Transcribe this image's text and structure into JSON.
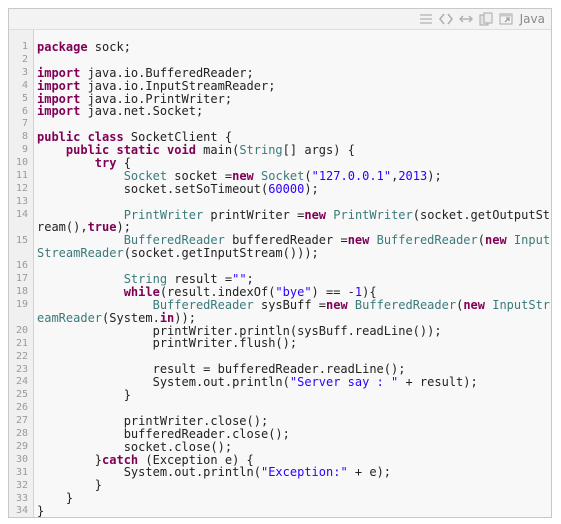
{
  "toolbar": {
    "language": "Java",
    "icons": [
      "view-source-icon",
      "code-icon",
      "expand-icon",
      "copy-icon",
      "popup-icon"
    ]
  },
  "line_numbers": [
    "1",
    "2",
    "3",
    "4",
    "5",
    "6",
    "7",
    "8",
    "9",
    "10",
    "11",
    "12",
    "13",
    "14",
    "15",
    "16",
    "17",
    "18",
    "19",
    "20",
    "21",
    "22",
    "23",
    "24",
    "25",
    "26",
    "27",
    "28",
    "29",
    "30",
    "31",
    "32",
    "33",
    "34"
  ],
  "code_lines": [
    [
      [
        "kw",
        "package"
      ],
      [
        "pl",
        " sock;"
      ]
    ],
    [],
    [
      [
        "kw",
        "import"
      ],
      [
        "pl",
        " java.io.BufferedReader;"
      ]
    ],
    [
      [
        "kw",
        "import"
      ],
      [
        "pl",
        " java.io.InputStreamReader;"
      ]
    ],
    [
      [
        "kw",
        "import"
      ],
      [
        "pl",
        " java.io.PrintWriter;"
      ]
    ],
    [
      [
        "kw",
        "import"
      ],
      [
        "pl",
        " java.net.Socket;"
      ]
    ],
    [],
    [
      [
        "kw",
        "public class"
      ],
      [
        "pl",
        " SocketClient {"
      ]
    ],
    [
      [
        "pl",
        "    "
      ],
      [
        "kw",
        "public static void"
      ],
      [
        "pl",
        " main("
      ],
      [
        "ty",
        "String"
      ],
      [
        "pl",
        "[] args) {"
      ]
    ],
    [
      [
        "pl",
        "        "
      ],
      [
        "kw",
        "try"
      ],
      [
        "pl",
        " {"
      ]
    ],
    [
      [
        "pl",
        "            "
      ],
      [
        "ty",
        "Socket"
      ],
      [
        "pl",
        " socket ="
      ],
      [
        "kw",
        "new"
      ],
      [
        "pl",
        " "
      ],
      [
        "ty",
        "Socket"
      ],
      [
        "pl",
        "("
      ],
      [
        "st",
        "\"127.0.0.1\""
      ],
      [
        "pl",
        ","
      ],
      [
        "nm",
        "2013"
      ],
      [
        "pl",
        ");"
      ]
    ],
    [
      [
        "pl",
        "            socket.setSoTimeout("
      ],
      [
        "nm",
        "60000"
      ],
      [
        "pl",
        ");"
      ]
    ],
    [],
    [
      [
        "pl",
        "            "
      ],
      [
        "ty",
        "PrintWriter"
      ],
      [
        "pl",
        " printWriter ="
      ],
      [
        "kw",
        "new"
      ],
      [
        "pl",
        " "
      ],
      [
        "ty",
        "PrintWriter"
      ],
      [
        "pl",
        "(socket.getOutputSt"
      ]
    ],
    [
      [
        "pl",
        "ream(),"
      ],
      [
        "kw",
        "true"
      ],
      [
        "pl",
        ");"
      ]
    ],
    [
      [
        "pl",
        "            "
      ],
      [
        "ty",
        "BufferedReader"
      ],
      [
        "pl",
        " bufferedReader ="
      ],
      [
        "kw",
        "new"
      ],
      [
        "pl",
        " "
      ],
      [
        "ty",
        "BufferedReader"
      ],
      [
        "pl",
        "("
      ],
      [
        "kw",
        "new"
      ],
      [
        "pl",
        " "
      ],
      [
        "ty",
        "Input"
      ]
    ],
    [
      [
        "ty",
        "StreamReader"
      ],
      [
        "pl",
        "(socket.getInputStream()));"
      ]
    ],
    [],
    [
      [
        "pl",
        "            "
      ],
      [
        "ty",
        "String"
      ],
      [
        "pl",
        " result ="
      ],
      [
        "st",
        "\"\""
      ],
      [
        "pl",
        ";"
      ]
    ],
    [
      [
        "pl",
        "            "
      ],
      [
        "kw",
        "while"
      ],
      [
        "pl",
        "(result.indexOf("
      ],
      [
        "st",
        "\"bye\""
      ],
      [
        "pl",
        ") == -"
      ],
      [
        "nm",
        "1"
      ],
      [
        "pl",
        "){"
      ]
    ],
    [
      [
        "pl",
        "                "
      ],
      [
        "ty",
        "BufferedReader"
      ],
      [
        "pl",
        " sysBuff ="
      ],
      [
        "kw",
        "new"
      ],
      [
        "pl",
        " "
      ],
      [
        "ty",
        "BufferedReader"
      ],
      [
        "pl",
        "("
      ],
      [
        "kw",
        "new"
      ],
      [
        "pl",
        " "
      ],
      [
        "ty",
        "InputStr"
      ]
    ],
    [
      [
        "ty",
        "eamReader"
      ],
      [
        "pl",
        "(System."
      ],
      [
        "kw",
        "in"
      ],
      [
        "pl",
        "));"
      ]
    ],
    [
      [
        "pl",
        "                printWriter.println(sysBuff.readLine());"
      ]
    ],
    [
      [
        "pl",
        "                printWriter.flush();"
      ]
    ],
    [],
    [
      [
        "pl",
        "                result = bufferedReader.readLine();"
      ]
    ],
    [
      [
        "pl",
        "                System.out.println("
      ],
      [
        "st",
        "\"Server say : \""
      ],
      [
        "pl",
        " + result);"
      ]
    ],
    [
      [
        "pl",
        "            }"
      ]
    ],
    [],
    [
      [
        "pl",
        "            printWriter.close();"
      ]
    ],
    [
      [
        "pl",
        "            bufferedReader.close();"
      ]
    ],
    [
      [
        "pl",
        "            socket.close();"
      ]
    ],
    [
      [
        "pl",
        "        }"
      ],
      [
        "kw",
        "catch"
      ],
      [
        "pl",
        " (Exception e) {"
      ]
    ],
    [
      [
        "pl",
        "            System.out.println("
      ],
      [
        "st",
        "\"Exception:\""
      ],
      [
        "pl",
        " + e);"
      ]
    ],
    [
      [
        "pl",
        "        }"
      ]
    ],
    [
      [
        "pl",
        "    }"
      ]
    ],
    [
      [
        "pl",
        "}"
      ]
    ]
  ],
  "line_number_rows": [
    0,
    1,
    2,
    3,
    4,
    5,
    6,
    7,
    8,
    9,
    10,
    11,
    12,
    13,
    15,
    17,
    18,
    19,
    20,
    22,
    23,
    24,
    25,
    26,
    27,
    28,
    29,
    30,
    31,
    32,
    33,
    34,
    35,
    36
  ]
}
